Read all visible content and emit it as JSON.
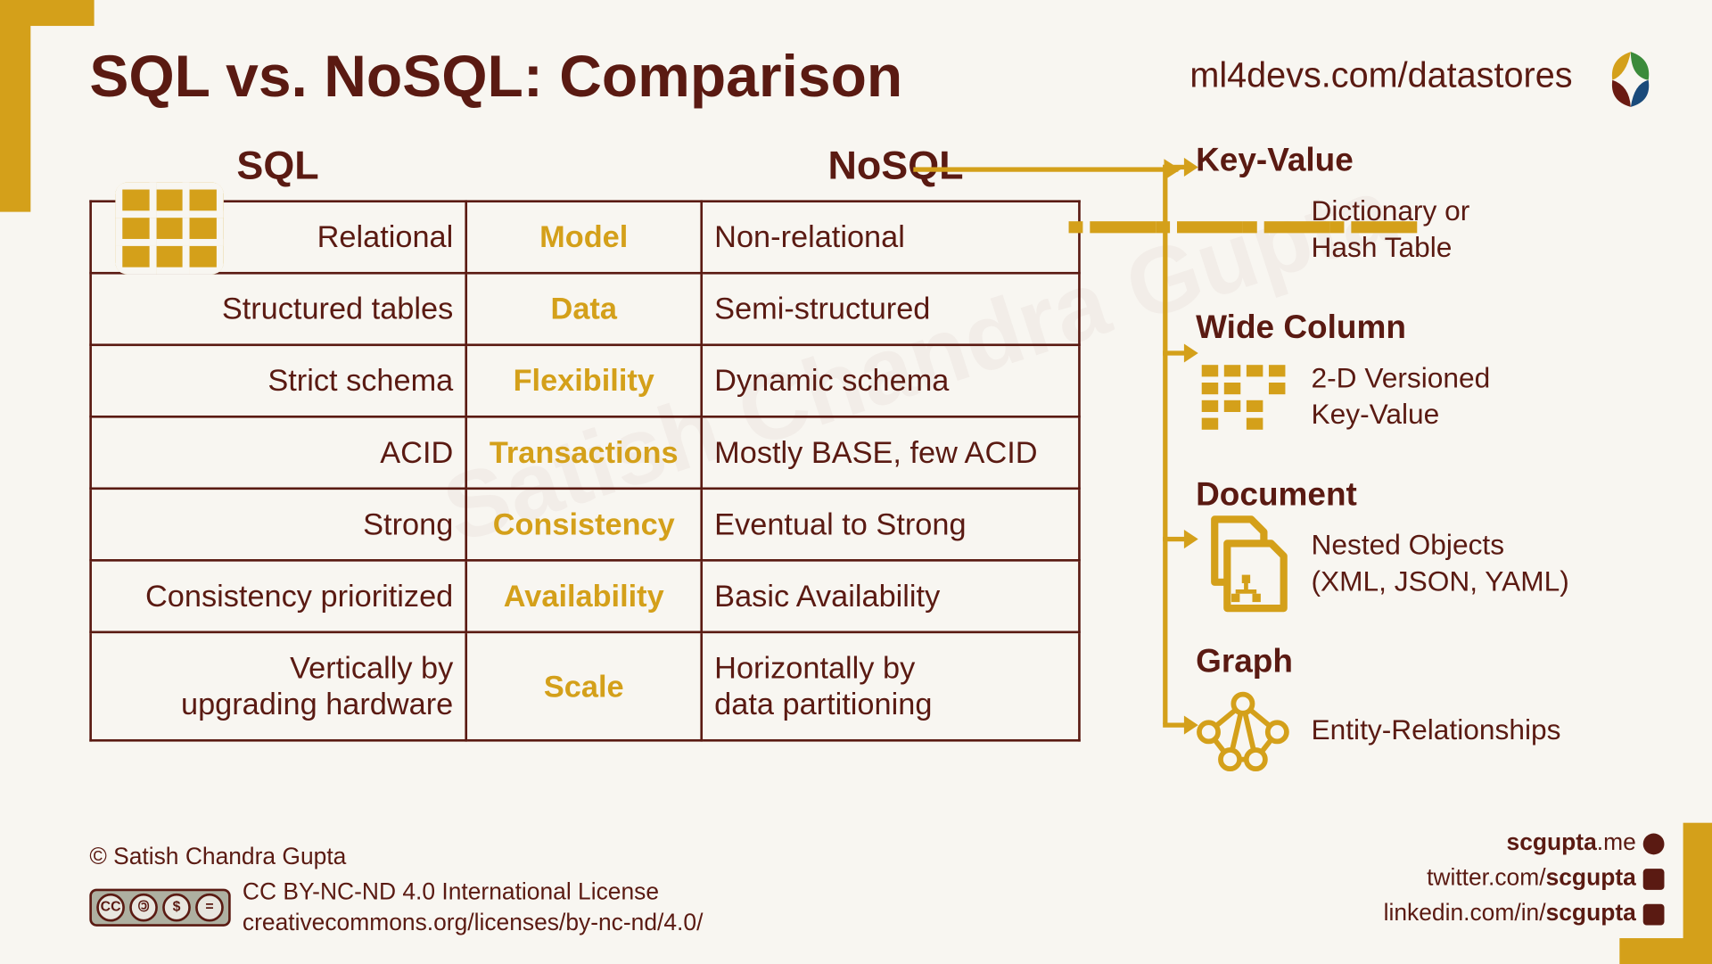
{
  "title": "SQL vs. NoSQL: Comparison",
  "top_url": "ml4devs.com/datastores",
  "headers": {
    "sql": "SQL",
    "nosql": "NoSQL"
  },
  "rows": [
    {
      "sql": "Relational",
      "mid": "Model",
      "nosql": "Non-relational"
    },
    {
      "sql": "Structured tables",
      "mid": "Data",
      "nosql": "Semi-structured"
    },
    {
      "sql": "Strict schema",
      "mid": "Flexibility",
      "nosql": "Dynamic schema"
    },
    {
      "sql": "ACID",
      "mid": "Transactions",
      "nosql": "Mostly BASE, few ACID"
    },
    {
      "sql": "Strong",
      "mid": "Consistency",
      "nosql": "Eventual to Strong"
    },
    {
      "sql": "Consistency prioritized",
      "mid": "Availability",
      "nosql": "Basic Availability"
    },
    {
      "sql": "Vertically by\nupgrading hardware",
      "mid": "Scale",
      "nosql": "Horizontally by\ndata partitioning"
    }
  ],
  "types": [
    {
      "title": "Key-Value",
      "desc": "Dictionary or\nHash Table"
    },
    {
      "title": "Wide Column",
      "desc": "2-D Versioned\nKey-Value"
    },
    {
      "title": "Document",
      "desc": "Nested Objects\n(XML, JSON, YAML)"
    },
    {
      "title": "Graph",
      "desc": "Entity-Relationships"
    }
  ],
  "footer": {
    "copyright": "© Satish Chandra Gupta",
    "license": "CC BY-NC-ND 4.0 International License",
    "license_url": "creativecommons.org/licenses/by-nc-nd/4.0/",
    "cc_labels": [
      "BY",
      "NC",
      "ND"
    ],
    "links": {
      "site_pre": "scgupta",
      "site_post": ".me",
      "tw_pre": "twitter.com/",
      "tw_bold": "scgupta",
      "li_pre": "linkedin.com/in/",
      "li_bold": "scgupta"
    }
  },
  "watermark": "Satish Chandra Gupta"
}
